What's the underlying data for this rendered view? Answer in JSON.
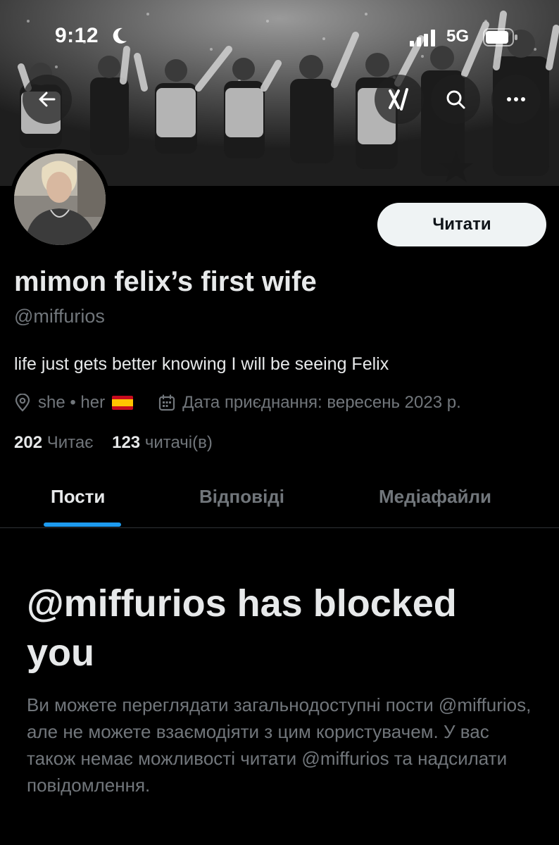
{
  "status_bar": {
    "time": "9:12",
    "network": "5G"
  },
  "header": {
    "back_icon": "arrow-left-icon",
    "grok_icon": "grok-icon",
    "search_icon": "search-icon",
    "more_icon": "more-horizontal-icon"
  },
  "profile": {
    "display_name": "mimon felix’s first wife",
    "handle": "@miffurios",
    "bio": "life just gets better knowing I will be seeing Felix",
    "location": "she • her",
    "joined": "Дата приєднання: вересень 2023 р.",
    "following_count": "202",
    "following_label": "Читає",
    "followers_count": "123",
    "followers_label": "читачі(в)",
    "follow_button": "Читати"
  },
  "tabs": [
    {
      "label": "Пости",
      "active": true
    },
    {
      "label": "Відповіді",
      "active": false
    },
    {
      "label": "Медіафайли",
      "active": false
    }
  ],
  "blocked": {
    "title": "@miffurios has blocked you",
    "description": "Ви можете переглядати загальнодоступні пости @miffurios, але не можете взаємодіяти з цим користувачем. У вас також немає можливості читати @miffurios та надсилати повідомлення."
  },
  "colors": {
    "accent": "#1d9bf0",
    "background": "#000000",
    "secondary_text": "#71767b"
  }
}
